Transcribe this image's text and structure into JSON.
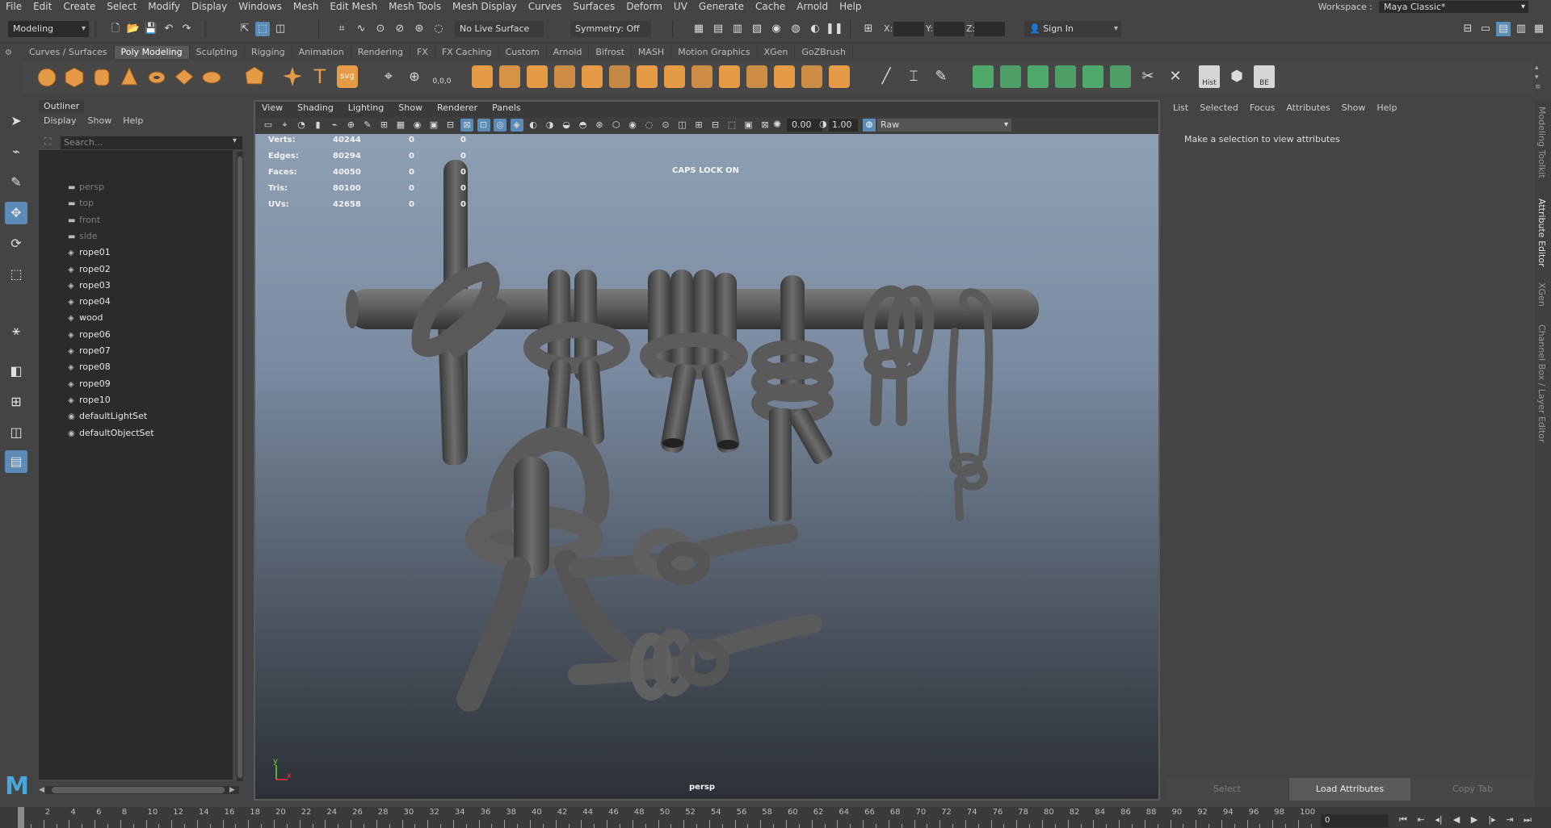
{
  "menubar": {
    "items": [
      "File",
      "Edit",
      "Create",
      "Select",
      "Modify",
      "Display",
      "Windows",
      "Mesh",
      "Edit Mesh",
      "Mesh Tools",
      "Mesh Display",
      "Curves",
      "Surfaces",
      "Deform",
      "UV",
      "Generate",
      "Cache",
      "Arnold",
      "Help"
    ],
    "workspace_label": "Workspace :",
    "workspace_value": "Maya Classic*"
  },
  "statusline": {
    "mode": "Modeling",
    "live_surface": "No Live Surface",
    "symmetry": "Symmetry: Off",
    "x_label": "X:",
    "y_label": "Y:",
    "z_label": "Z:",
    "sign_in": "Sign In"
  },
  "shelf": {
    "tabs": [
      "Curves / Surfaces",
      "Poly Modeling",
      "Sculpting",
      "Rigging",
      "Animation",
      "Rendering",
      "FX",
      "FX Caching",
      "Custom",
      "Arnold",
      "Bifrost",
      "MASH",
      "Motion Graphics",
      "XGen",
      "GoZBrush"
    ],
    "active_tab": "Poly Modeling",
    "hist_label": "Hist",
    "be_label": "BE",
    "svg_label": "svg",
    "counter_label": "0,0,0"
  },
  "outliner": {
    "title": "Outliner",
    "menus": [
      "Display",
      "Show",
      "Help"
    ],
    "search_placeholder": "Search...",
    "items": [
      {
        "label": "persp",
        "icon": "camera-icon",
        "dim": true
      },
      {
        "label": "top",
        "icon": "camera-icon",
        "dim": true
      },
      {
        "label": "front",
        "icon": "camera-icon",
        "dim": true
      },
      {
        "label": "side",
        "icon": "camera-icon",
        "dim": true
      },
      {
        "label": "rope01",
        "icon": "mesh-icon",
        "dim": false
      },
      {
        "label": "rope02",
        "icon": "mesh-icon",
        "dim": false
      },
      {
        "label": "rope03",
        "icon": "mesh-icon",
        "dim": false
      },
      {
        "label": "rope04",
        "icon": "mesh-icon",
        "dim": false
      },
      {
        "label": "wood",
        "icon": "mesh-icon",
        "dim": false
      },
      {
        "label": "rope06",
        "icon": "mesh-icon",
        "dim": false
      },
      {
        "label": "rope07",
        "icon": "mesh-icon",
        "dim": false
      },
      {
        "label": "rope08",
        "icon": "mesh-icon",
        "dim": false
      },
      {
        "label": "rope09",
        "icon": "mesh-icon",
        "dim": false
      },
      {
        "label": "rope10",
        "icon": "mesh-icon",
        "dim": false
      },
      {
        "label": "defaultLightSet",
        "icon": "set-icon",
        "dim": false
      },
      {
        "label": "defaultObjectSet",
        "icon": "set-icon",
        "dim": false
      }
    ]
  },
  "viewport": {
    "menus": [
      "View",
      "Shading",
      "Lighting",
      "Show",
      "Renderer",
      "Panels"
    ],
    "exposure": "0.00",
    "gamma": "1.00",
    "color_space": "Raw",
    "hud": {
      "rows": [
        {
          "label": "Verts:",
          "v1": "40244",
          "v2": "0",
          "v3": "0"
        },
        {
          "label": "Edges:",
          "v1": "80294",
          "v2": "0",
          "v3": "0"
        },
        {
          "label": "Faces:",
          "v1": "40050",
          "v2": "0",
          "v3": "0"
        },
        {
          "label": "Tris:",
          "v1": "80100",
          "v2": "0",
          "v3": "0"
        },
        {
          "label": "UVs:",
          "v1": "42658",
          "v2": "0",
          "v3": "0"
        }
      ],
      "caps_lock": "CAPS LOCK ON",
      "camera": "persp",
      "axis_y": "y",
      "axis_x": "x"
    }
  },
  "attribute_editor": {
    "menus": [
      "List",
      "Selected",
      "Focus",
      "Attributes",
      "Show",
      "Help"
    ],
    "message": "Make a selection to view attributes",
    "buttons": [
      "Select",
      "Load Attributes",
      "Copy Tab"
    ]
  },
  "right_tabs": [
    "Modeling Toolkit",
    "Attribute Editor",
    "XGen",
    "Channel Box / Layer Editor"
  ],
  "timeslider": {
    "ticks": [
      "0",
      "2",
      "4",
      "6",
      "8",
      "10",
      "12",
      "14",
      "16",
      "18",
      "20",
      "22",
      "24",
      "26",
      "28",
      "30",
      "32",
      "34",
      "36",
      "38",
      "40",
      "42",
      "44",
      "46",
      "48",
      "50",
      "52",
      "54",
      "56",
      "58",
      "60",
      "62",
      "64",
      "66",
      "68",
      "70",
      "72",
      "74",
      "76",
      "78",
      "80",
      "82",
      "84",
      "86",
      "88",
      "90",
      "92",
      "94",
      "96",
      "98",
      "100"
    ],
    "current_frame": "0"
  },
  "colors": {
    "accent": "#5b8bb7",
    "shelf_orange": "#e59a45",
    "shelf_green": "#4ea96a",
    "rope": "#5a5a5a"
  }
}
